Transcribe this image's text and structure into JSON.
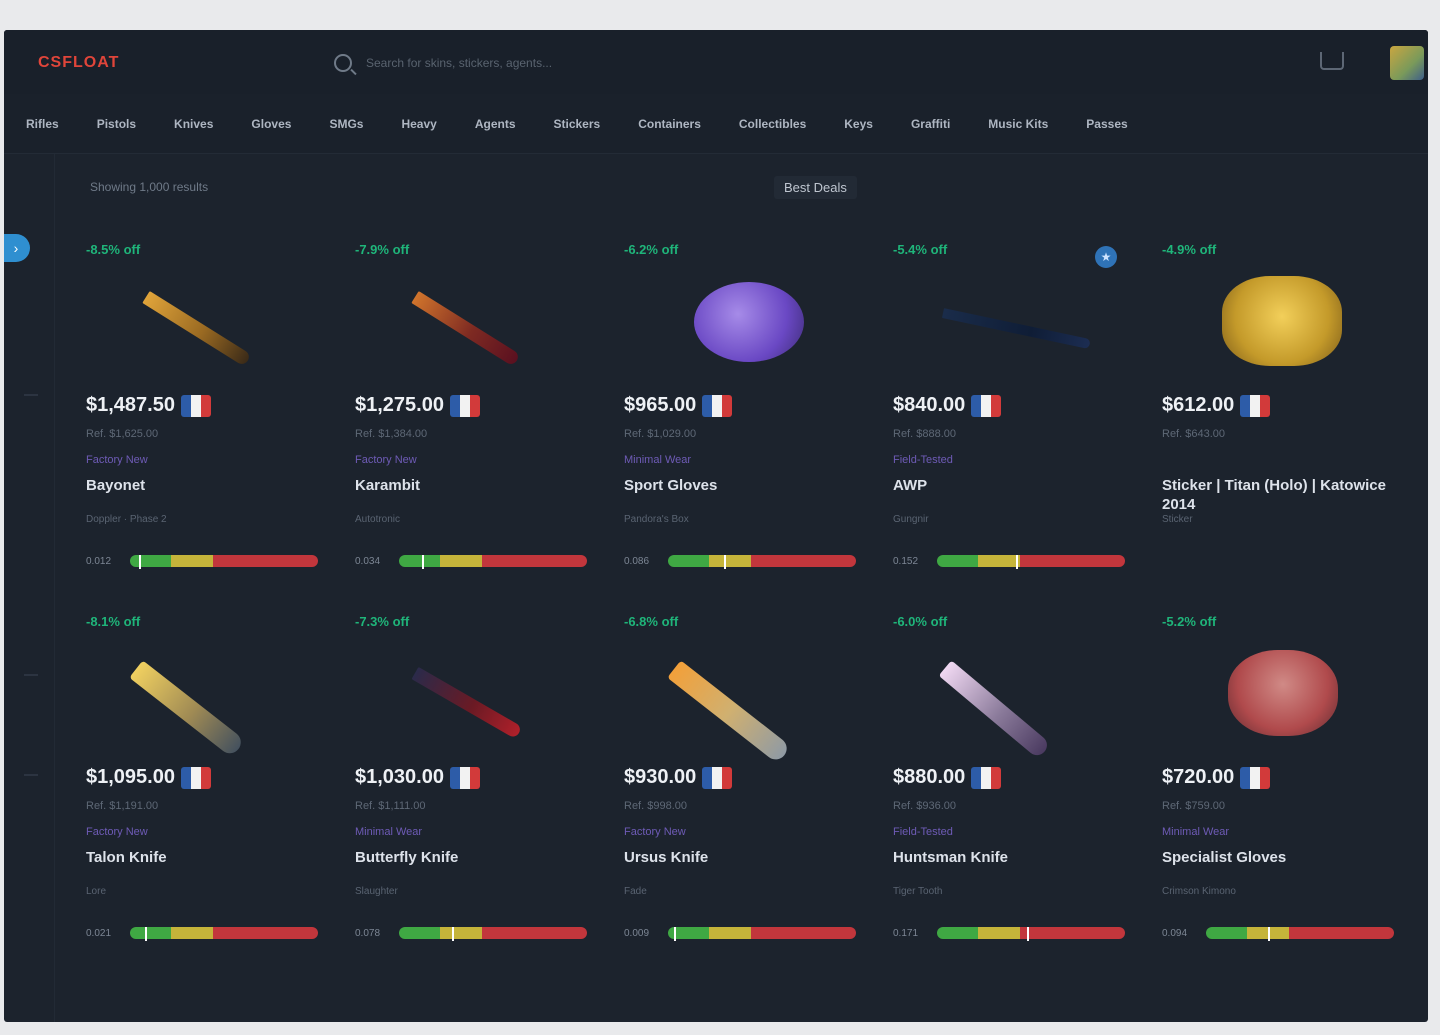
{
  "app": {
    "logo": "CSFLOAT"
  },
  "search": {
    "placeholder": "Search for skins, stickers, agents..."
  },
  "categories": [
    "Rifles",
    "Pistols",
    "Knives",
    "Gloves",
    "SMGs",
    "Heavy",
    "Agents",
    "Stickers",
    "Containers",
    "Collectibles",
    "Keys",
    "Graffiti",
    "Music Kits",
    "Passes"
  ],
  "toolbar": {
    "results": "Showing 1,000 results",
    "sort": "Best Deals"
  },
  "colors": {
    "accent": "#2f8fd0",
    "discount": "#1fb57a",
    "bg": "#1c232d"
  },
  "items": [
    {
      "discount": "-8.5% off",
      "price": "$1,487.50",
      "ref": "Ref. $1,625.00",
      "wear": "Factory New",
      "name": "Bayonet",
      "sub": "Doppler · Phase 2",
      "float": "0.012",
      "marker": 0.05,
      "art": "knife-gold",
      "fav": false
    },
    {
      "discount": "-7.9% off",
      "price": "$1,275.00",
      "ref": "Ref. $1,384.00",
      "wear": "Factory New",
      "name": "Karambit",
      "sub": "Autotronic",
      "float": "0.034",
      "marker": 0.12,
      "art": "knife-red",
      "fav": false
    },
    {
      "discount": "-6.2% off",
      "price": "$965.00",
      "ref": "Ref. $1,029.00",
      "wear": "Minimal Wear",
      "name": "Sport Gloves",
      "sub": "Pandora's Box",
      "float": "0.086",
      "marker": 0.3,
      "art": "gem-purple",
      "fav": false
    },
    {
      "discount": "-5.4% off",
      "price": "$840.00",
      "ref": "Ref. $888.00",
      "wear": "Field-Tested",
      "name": "AWP",
      "sub": "Gungnir",
      "float": "0.152",
      "marker": 0.42,
      "art": "rifle-dark",
      "fav": true
    },
    {
      "discount": "-4.9% off",
      "price": "$612.00",
      "ref": "Ref. $643.00",
      "wear": "",
      "name": "Sticker | Titan (Holo) | Katowice 2014",
      "sub": "Sticker",
      "float": "",
      "marker": null,
      "art": "gem-gold",
      "fav": false
    },
    {
      "discount": "-8.1% off",
      "price": "$1,095.00",
      "ref": "Ref. $1,191.00",
      "wear": "Factory New",
      "name": "Talon Knife",
      "sub": "Lore",
      "float": "0.021",
      "marker": 0.08,
      "art": "knife-curve-gold",
      "fav": false
    },
    {
      "discount": "-7.3% off",
      "price": "$1,030.00",
      "ref": "Ref. $1,111.00",
      "wear": "Minimal Wear",
      "name": "Butterfly Knife",
      "sub": "Slaughter",
      "float": "0.078",
      "marker": 0.28,
      "art": "knife-dark-red",
      "fav": false
    },
    {
      "discount": "-6.8% off",
      "price": "$930.00",
      "ref": "Ref. $998.00",
      "wear": "Factory New",
      "name": "Ursus Knife",
      "sub": "Fade",
      "float": "0.009",
      "marker": 0.03,
      "art": "knife-curve-orange",
      "fav": false
    },
    {
      "discount": "-6.0% off",
      "price": "$880.00",
      "ref": "Ref. $936.00",
      "wear": "Field-Tested",
      "name": "Huntsman Knife",
      "sub": "Tiger Tooth",
      "float": "0.171",
      "marker": 0.48,
      "art": "knife-curve-white",
      "fav": false
    },
    {
      "discount": "-5.2% off",
      "price": "$720.00",
      "ref": "Ref. $759.00",
      "wear": "Minimal Wear",
      "name": "Specialist Gloves",
      "sub": "Crimson Kimono",
      "float": "0.094",
      "marker": 0.33,
      "art": "gem-red",
      "fav": false
    }
  ]
}
